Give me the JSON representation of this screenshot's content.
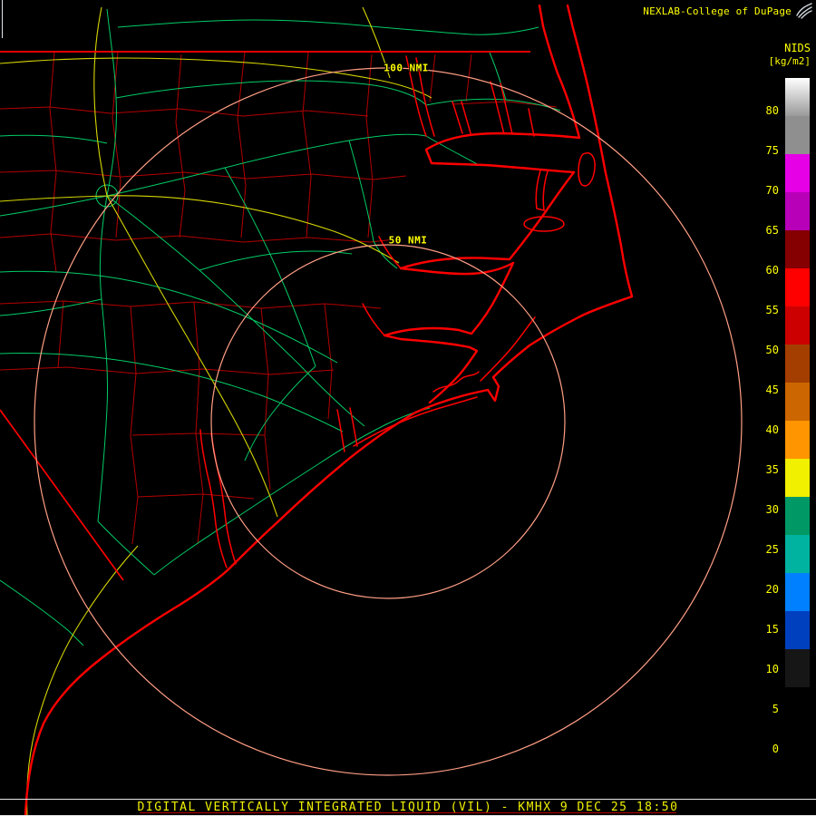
{
  "colors": {
    "background": "#000000",
    "coastline": "#ff0000",
    "state_border": "#ff0000",
    "county": "#b40000",
    "road": "#00cc66",
    "highway": "#d6d600",
    "range_ring": "#ff9e85",
    "map_label": "#ffff00",
    "scale_label": "#ffff00",
    "header_text": "#ffff00",
    "footer_text": "#f0f000",
    "footer_rule": "#e8e8e8",
    "footer_underline": "#b40000"
  },
  "header": {
    "attribution": "NEXLAB-College of DuPage",
    "logo_icon": "cod-logo"
  },
  "colorbar": {
    "title": "NIDS",
    "units": "[kg/m2]",
    "segments": [
      {
        "label": "80",
        "color": "#ffffff",
        "color2": "#9a9a9a"
      },
      {
        "label": "75",
        "color": "#8f8f8f"
      },
      {
        "label": "70",
        "color": "#e600e6"
      },
      {
        "label": "65",
        "color": "#b800b8"
      },
      {
        "label": "60",
        "color": "#850000"
      },
      {
        "label": "55",
        "color": "#ff0000"
      },
      {
        "label": "50",
        "color": "#cc0000"
      },
      {
        "label": "45",
        "color": "#a33e00"
      },
      {
        "label": "40",
        "color": "#cc6600"
      },
      {
        "label": "35",
        "color": "#ff9500"
      },
      {
        "label": "30",
        "color": "#f0f000"
      },
      {
        "label": "25",
        "color": "#009966"
      },
      {
        "label": "20",
        "color": "#00b3a0"
      },
      {
        "label": "15",
        "color": "#0080ff"
      },
      {
        "label": "10",
        "color": "#0040bf"
      },
      {
        "label": "5",
        "color": "#161616"
      },
      {
        "label": "0",
        "color": "#000000"
      }
    ]
  },
  "range_rings": {
    "outer_label": "100 NMI",
    "inner_label": "50 NMI"
  },
  "footer": {
    "product_title": "DIGITAL VERTICALLY INTEGRATED LIQUID (VIL) - KMHX 9 DEC 25 18:50"
  }
}
